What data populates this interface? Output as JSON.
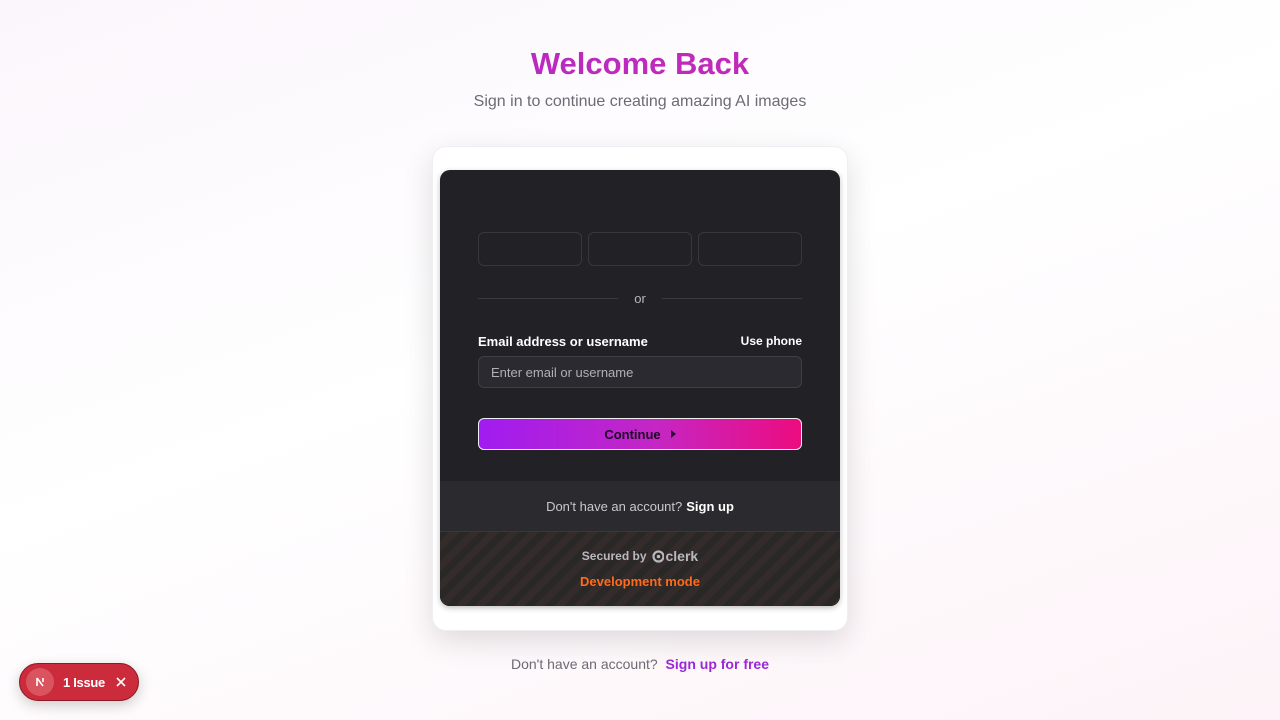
{
  "header": {
    "title": "Welcome Back",
    "subtitle": "Sign in to continue creating amazing AI images"
  },
  "signin": {
    "divider_text": "or",
    "email_label": "Email address or username",
    "use_phone_label": "Use phone",
    "email_value": "",
    "email_placeholder": "Enter email or username",
    "continue_label": "Continue",
    "no_account_text": "Don't have an account?",
    "signup_link": "Sign up",
    "secured_by": "Secured by",
    "clerk_brand": "clerk",
    "dev_mode": "Development mode"
  },
  "footer": {
    "no_account_text": "Don't have an account?",
    "signup_link": "Sign up for free"
  },
  "issues_badge": {
    "label": "1 Issue"
  },
  "icons": {
    "continue": "play-triangle-icon",
    "clerk": "clerk-logo-icon",
    "issue": "nextjs-logo-icon",
    "close": "close-icon"
  },
  "colors": {
    "title_gradient_start": "#a62bd6",
    "title_gradient_end": "#d42aa3",
    "card_bg": "#212126",
    "button_gradient_start": "#a01cf0",
    "button_gradient_end": "#ec0c7f",
    "dev_mode": "#ff6b1a",
    "link": "#9b27d6",
    "issue_badge": "#cb2b3b"
  }
}
